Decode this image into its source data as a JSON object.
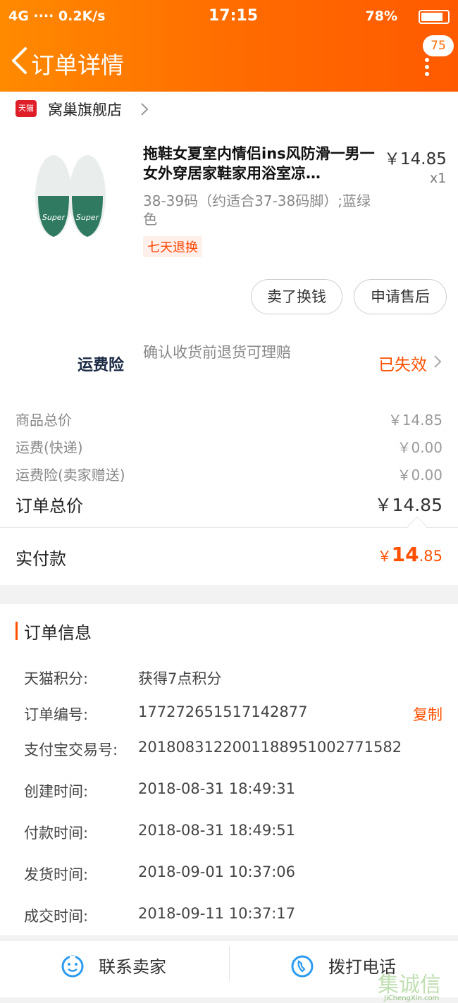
{
  "status_bar": {
    "left": "4G ∙∙∙∙ 0.2K/s",
    "time": "17:15",
    "battery": "78%"
  },
  "nav": {
    "title": "订单详情",
    "badge": "75"
  },
  "shop": {
    "badge": "天猫",
    "name": "窝巢旗舰店"
  },
  "product": {
    "title": "拖鞋女夏室内情侣ins风防滑一男一女外穿居家鞋家用浴室凉…",
    "price": "￥14.85",
    "qty": "x1",
    "sku": "38-39码（约适合37-38码脚）;蓝绿色",
    "tag": "七天退换",
    "image_text": "Super"
  },
  "actions": {
    "resell": "卖了换钱",
    "after_sale": "申请售后"
  },
  "insurance": {
    "label": "运费险",
    "desc": "确认收货前退货可理赔",
    "status": "已失效"
  },
  "summary": {
    "lines": [
      {
        "label": "商品总价",
        "value": "￥14.85"
      },
      {
        "label": "运费(快递)",
        "value": "￥0.00"
      },
      {
        "label": "运费险(卖家赠送)",
        "value": "￥0.00"
      }
    ],
    "total_label": "订单总价",
    "total_value": "￥14.85",
    "paid_label": "实付款",
    "paid_currency": "￥",
    "paid_int": "14",
    "paid_dec": ".85"
  },
  "order_info": {
    "title": "订单信息",
    "copy_label": "复制",
    "rows": [
      {
        "key": "天猫积分:",
        "value": "获得7点积分"
      },
      {
        "key": "订单编号:",
        "value": "177272651517142877"
      },
      {
        "key": "支付宝交易号:",
        "value": "2018083122001188951002771582"
      },
      {
        "key": "创建时间:",
        "value": "2018-08-31 18:49:31"
      },
      {
        "key": "付款时间:",
        "value": "2018-08-31 18:49:51"
      },
      {
        "key": "发货时间:",
        "value": "2018-09-01 10:37:06"
      },
      {
        "key": "成交时间:",
        "value": "2018-09-11 10:37:17"
      }
    ]
  },
  "bottom": {
    "contact": "联系卖家",
    "call": "拨打电话"
  },
  "watermark": {
    "main": "集诚信",
    "sub": "JiChengXin.com"
  },
  "colors": {
    "accent": "#ff5000",
    "header_start": "#ff8a00",
    "header_end": "#ff5a00"
  }
}
